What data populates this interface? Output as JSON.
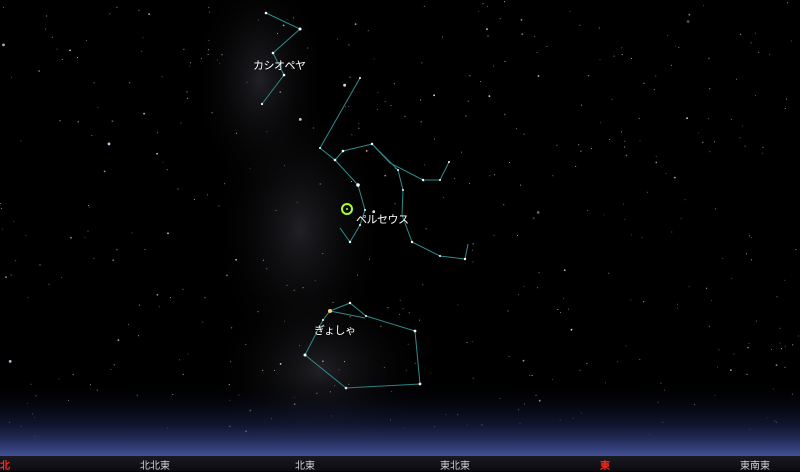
{
  "constellations": [
    {
      "id": "cassiopeia",
      "label": "カシオペヤ"
    },
    {
      "id": "perseus",
      "label": "ペルセウス"
    },
    {
      "id": "auriga",
      "label": "ぎょしゃ"
    }
  ],
  "compass": [
    {
      "label": "北",
      "cardinal": true
    },
    {
      "label": "北北東",
      "cardinal": false
    },
    {
      "label": "北東",
      "cardinal": false
    },
    {
      "label": "東北東",
      "cardinal": false
    },
    {
      "label": "東",
      "cardinal": true
    },
    {
      "label": "東南東",
      "cardinal": false
    }
  ],
  "colors": {
    "sky": "#000000",
    "constellation_line": "#2f8c8c",
    "target_marker": "#a6ff2a",
    "cardinal": "#ff2a1a",
    "horizon_glow": "#3a4a8a"
  },
  "icons": {
    "target_marker": "circle-target-icon"
  }
}
